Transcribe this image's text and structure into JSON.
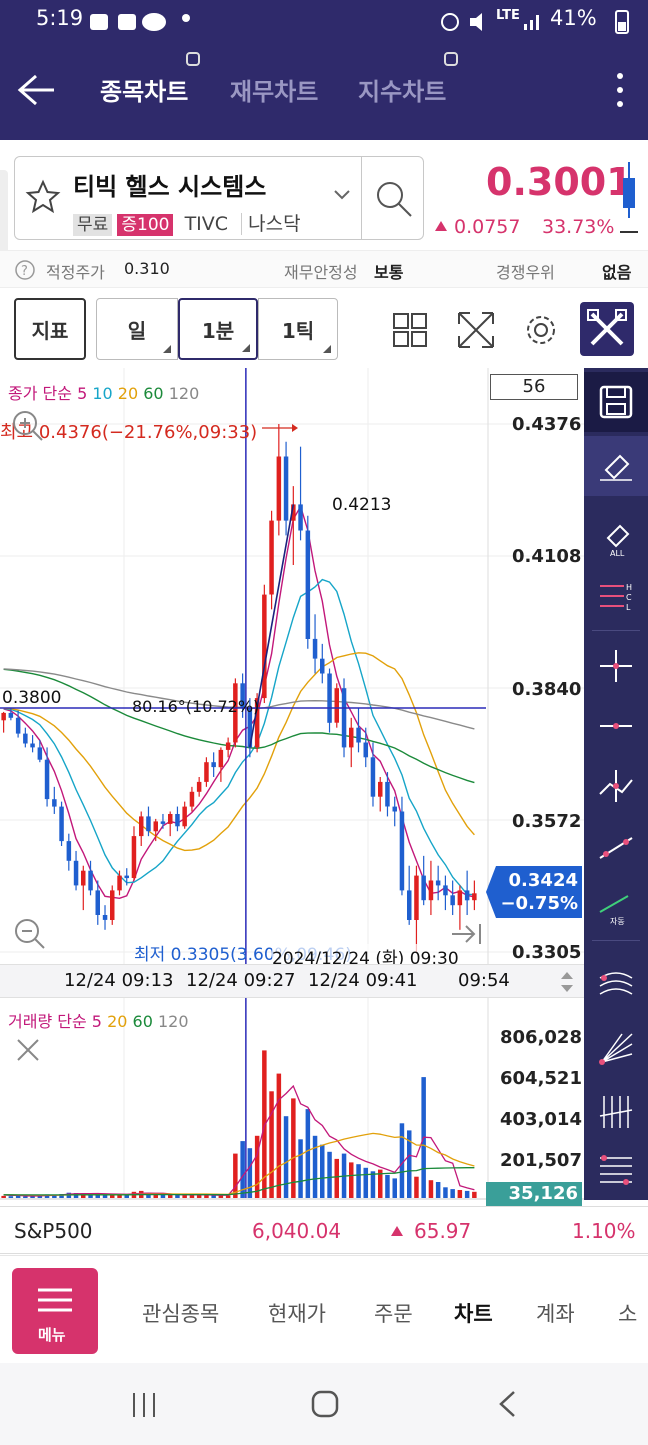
{
  "status_bar": {
    "time": "5:19",
    "battery": "41%",
    "network": "LTE"
  },
  "header": {
    "tabs": [
      {
        "label": "종목차트",
        "active": true
      },
      {
        "label": "재무차트",
        "active": false
      },
      {
        "label": "지수차트",
        "active": false
      }
    ]
  },
  "stock": {
    "name": "티빅 헬스 시스템스",
    "badges": [
      "무료",
      "증100"
    ],
    "ticker": "TIVC",
    "market": "나스닥",
    "price": "0.3001",
    "change": "0.0757",
    "change_pct": "33.73%"
  },
  "info_strip": {
    "fair_price_label": "적정주가",
    "fair_price": "0.310",
    "stability_label": "재무안정성",
    "stability": "보통",
    "competition_label": "경쟁우위",
    "competition": "없음"
  },
  "toolbar": {
    "indicator": "지표",
    "period": "일",
    "minute": "1분",
    "tick": "1틱"
  },
  "chart_data": {
    "type": "candlestick",
    "ma_legend": {
      "prefix": "종가 단순",
      "periods": [
        "5",
        "10",
        "20",
        "60",
        "120"
      ]
    },
    "count_box": "56",
    "price_ticks": [
      "0.4376",
      "0.4108",
      "0.3840",
      "0.3572",
      "0.3305"
    ],
    "high_label": "최고 0.4376(−21.76%,09:33)",
    "low_label": "최저 0.3305(3.60%,09:46)",
    "crosshair_price": "0.3800",
    "trendline_label": "80.16°(10.72%)",
    "point_label": "0.4213",
    "current_price": "0.3424",
    "current_change": "−0.75%",
    "crosshair_time": "2024/12/24 (화) 09:30",
    "time_ticks": [
      "12/24 09:13",
      "12/24 09:27",
      "12/24 09:41",
      "09:54"
    ],
    "ylim": [
      0.3305,
      0.4376
    ],
    "candles": [
      {
        "o": 0.3775,
        "h": 0.3792,
        "l": 0.375,
        "c": 0.379
      },
      {
        "o": 0.379,
        "h": 0.38,
        "l": 0.3775,
        "c": 0.378
      },
      {
        "o": 0.378,
        "h": 0.3795,
        "l": 0.374,
        "c": 0.3748
      },
      {
        "o": 0.3748,
        "h": 0.376,
        "l": 0.372,
        "c": 0.3728
      },
      {
        "o": 0.3728,
        "h": 0.3745,
        "l": 0.371,
        "c": 0.372
      },
      {
        "o": 0.372,
        "h": 0.3735,
        "l": 0.369,
        "c": 0.3695
      },
      {
        "o": 0.3695,
        "h": 0.372,
        "l": 0.36,
        "c": 0.3615
      },
      {
        "o": 0.3615,
        "h": 0.364,
        "l": 0.3585,
        "c": 0.36
      },
      {
        "o": 0.36,
        "h": 0.361,
        "l": 0.352,
        "c": 0.353
      },
      {
        "o": 0.353,
        "h": 0.3545,
        "l": 0.347,
        "c": 0.349
      },
      {
        "o": 0.349,
        "h": 0.351,
        "l": 0.343,
        "c": 0.344
      },
      {
        "o": 0.344,
        "h": 0.348,
        "l": 0.339,
        "c": 0.347
      },
      {
        "o": 0.347,
        "h": 0.349,
        "l": 0.342,
        "c": 0.343
      },
      {
        "o": 0.343,
        "h": 0.345,
        "l": 0.336,
        "c": 0.338
      },
      {
        "o": 0.338,
        "h": 0.34,
        "l": 0.335,
        "c": 0.337
      },
      {
        "o": 0.337,
        "h": 0.344,
        "l": 0.336,
        "c": 0.343
      },
      {
        "o": 0.343,
        "h": 0.347,
        "l": 0.342,
        "c": 0.346
      },
      {
        "o": 0.346,
        "h": 0.3475,
        "l": 0.344,
        "c": 0.3455
      },
      {
        "o": 0.3455,
        "h": 0.356,
        "l": 0.345,
        "c": 0.354
      },
      {
        "o": 0.354,
        "h": 0.359,
        "l": 0.352,
        "c": 0.358
      },
      {
        "o": 0.358,
        "h": 0.36,
        "l": 0.354,
        "c": 0.355
      },
      {
        "o": 0.355,
        "h": 0.3575,
        "l": 0.353,
        "c": 0.357
      },
      {
        "o": 0.357,
        "h": 0.3585,
        "l": 0.3555,
        "c": 0.3565
      },
      {
        "o": 0.3565,
        "h": 0.359,
        "l": 0.354,
        "c": 0.3585
      },
      {
        "o": 0.3585,
        "h": 0.36,
        "l": 0.355,
        "c": 0.356
      },
      {
        "o": 0.356,
        "h": 0.361,
        "l": 0.3555,
        "c": 0.36
      },
      {
        "o": 0.36,
        "h": 0.364,
        "l": 0.359,
        "c": 0.363
      },
      {
        "o": 0.363,
        "h": 0.366,
        "l": 0.362,
        "c": 0.365
      },
      {
        "o": 0.365,
        "h": 0.37,
        "l": 0.364,
        "c": 0.369
      },
      {
        "o": 0.369,
        "h": 0.371,
        "l": 0.366,
        "c": 0.368
      },
      {
        "o": 0.368,
        "h": 0.372,
        "l": 0.365,
        "c": 0.3715
      },
      {
        "o": 0.3715,
        "h": 0.374,
        "l": 0.37,
        "c": 0.373
      },
      {
        "o": 0.373,
        "h": 0.386,
        "l": 0.372,
        "c": 0.385
      },
      {
        "o": 0.385,
        "h": 0.387,
        "l": 0.378,
        "c": 0.38
      },
      {
        "o": 0.38,
        "h": 0.382,
        "l": 0.37,
        "c": 0.372
      },
      {
        "o": 0.372,
        "h": 0.383,
        "l": 0.371,
        "c": 0.382
      },
      {
        "o": 0.382,
        "h": 0.405,
        "l": 0.381,
        "c": 0.403
      },
      {
        "o": 0.403,
        "h": 0.42,
        "l": 0.4,
        "c": 0.418
      },
      {
        "o": 0.418,
        "h": 0.4376,
        "l": 0.415,
        "c": 0.431
      },
      {
        "o": 0.431,
        "h": 0.434,
        "l": 0.415,
        "c": 0.418
      },
      {
        "o": 0.418,
        "h": 0.425,
        "l": 0.409,
        "c": 0.4213
      },
      {
        "o": 0.4213,
        "h": 0.433,
        "l": 0.414,
        "c": 0.416
      },
      {
        "o": 0.416,
        "h": 0.419,
        "l": 0.392,
        "c": 0.394
      },
      {
        "o": 0.394,
        "h": 0.399,
        "l": 0.387,
        "c": 0.39
      },
      {
        "o": 0.39,
        "h": 0.393,
        "l": 0.385,
        "c": 0.387
      },
      {
        "o": 0.387,
        "h": 0.388,
        "l": 0.375,
        "c": 0.377
      },
      {
        "o": 0.377,
        "h": 0.385,
        "l": 0.376,
        "c": 0.384
      },
      {
        "o": 0.384,
        "h": 0.386,
        "l": 0.37,
        "c": 0.372
      },
      {
        "o": 0.372,
        "h": 0.378,
        "l": 0.368,
        "c": 0.376
      },
      {
        "o": 0.376,
        "h": 0.38,
        "l": 0.371,
        "c": 0.373
      },
      {
        "o": 0.373,
        "h": 0.376,
        "l": 0.368,
        "c": 0.37
      },
      {
        "o": 0.37,
        "h": 0.373,
        "l": 0.36,
        "c": 0.362
      },
      {
        "o": 0.362,
        "h": 0.366,
        "l": 0.359,
        "c": 0.365
      },
      {
        "o": 0.365,
        "h": 0.367,
        "l": 0.358,
        "c": 0.36
      },
      {
        "o": 0.36,
        "h": 0.362,
        "l": 0.356,
        "c": 0.359
      },
      {
        "o": 0.359,
        "h": 0.362,
        "l": 0.342,
        "c": 0.343
      },
      {
        "o": 0.343,
        "h": 0.348,
        "l": 0.336,
        "c": 0.337
      },
      {
        "o": 0.337,
        "h": 0.348,
        "l": 0.3305,
        "c": 0.346
      },
      {
        "o": 0.346,
        "h": 0.35,
        "l": 0.34,
        "c": 0.341
      },
      {
        "o": 0.341,
        "h": 0.349,
        "l": 0.338,
        "c": 0.345
      },
      {
        "o": 0.345,
        "h": 0.348,
        "l": 0.341,
        "c": 0.344
      },
      {
        "o": 0.344,
        "h": 0.346,
        "l": 0.339,
        "c": 0.342
      },
      {
        "o": 0.342,
        "h": 0.345,
        "l": 0.338,
        "c": 0.34
      },
      {
        "o": 0.34,
        "h": 0.344,
        "l": 0.335,
        "c": 0.343
      },
      {
        "o": 0.343,
        "h": 0.347,
        "l": 0.338,
        "c": 0.341
      },
      {
        "o": 0.341,
        "h": 0.345,
        "l": 0.339,
        "c": 0.3424
      }
    ],
    "volume_legend": {
      "prefix": "거래량 단순",
      "periods": [
        "5",
        "20",
        "60",
        "120"
      ]
    },
    "volume_ticks": [
      "806,028",
      "604,521",
      "403,014",
      "201,507"
    ],
    "volume_current": "35,126",
    "volume_ylim": [
      0,
      900000
    ],
    "volumes": [
      12000,
      10000,
      14000,
      9000,
      11000,
      16000,
      20000,
      18000,
      22000,
      30000,
      28000,
      25000,
      20000,
      24000,
      22000,
      21000,
      19000,
      18000,
      35000,
      40000,
      22000,
      18000,
      17000,
      19000,
      21000,
      16000,
      15000,
      17000,
      18000,
      16000,
      14000,
      15000,
      250000,
      320000,
      280000,
      350000,
      830000,
      600000,
      700000,
      460000,
      560000,
      330000,
      500000,
      350000,
      300000,
      260000,
      220000,
      250000,
      200000,
      190000,
      170000,
      150000,
      160000,
      130000,
      110000,
      420000,
      380000,
      120000,
      680000,
      100000,
      90000,
      60000,
      50000,
      45000,
      40000,
      35126
    ]
  },
  "index_bar": {
    "name": "S&P500",
    "value": "6,040.04",
    "change": "65.97",
    "pct": "1.10%"
  },
  "bottom_nav": {
    "menu_label": "메뉴",
    "items": [
      "관심종목",
      "현재가",
      "주문",
      "차트",
      "계좌",
      "소"
    ]
  },
  "colors": {
    "header_bg": "#2f2a6b",
    "up": "#e0201f",
    "down": "#1f5fcf",
    "accent_pink": "#d6336c",
    "rail_bg": "#2b2b5e"
  }
}
